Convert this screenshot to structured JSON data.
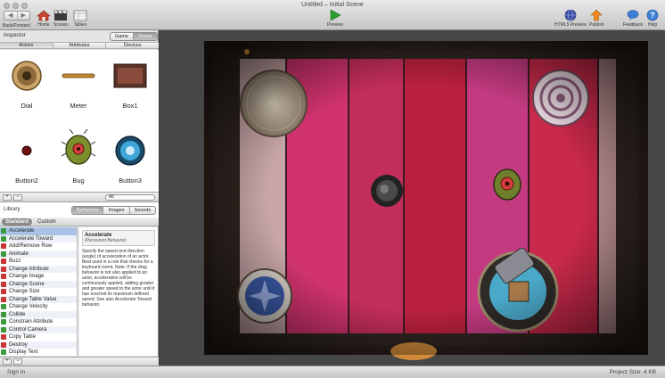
{
  "window": {
    "title": "Untitled – Initial Scene"
  },
  "toolbar": {
    "nav_back": "◀",
    "nav_forward": "▶",
    "nav_label": "Back/Forward",
    "home": "Home",
    "scenes": "Scenes",
    "tables": "Tables",
    "preview": "Preview",
    "html5_preview": "HTML5 Preview",
    "publish": "Publish",
    "feedback": "Feedback",
    "help": "Help"
  },
  "inspector": {
    "title": "Inspector",
    "scope_game": "Game",
    "scope_scene": "Scene",
    "tabs": [
      "Actors",
      "Attributes",
      "Devices"
    ],
    "actors": [
      {
        "name": "Dial",
        "icon": "dial-icon"
      },
      {
        "name": "Meter",
        "icon": "meter-icon"
      },
      {
        "name": "Box1",
        "icon": "box-icon"
      },
      {
        "name": "Button2",
        "icon": "button2-icon"
      },
      {
        "name": "Bug",
        "icon": "bug-icon"
      },
      {
        "name": "Button3",
        "icon": "button3-icon"
      }
    ],
    "add": "+",
    "remove": "−",
    "filter": "All"
  },
  "library": {
    "title": "Library",
    "tabs": [
      "Behaviors",
      "Images",
      "Sounds"
    ],
    "standard": "Standard",
    "custom": "Custom",
    "behaviors": [
      {
        "label": "Accelerate",
        "kind": "g"
      },
      {
        "label": "Accelerate Toward",
        "kind": "g"
      },
      {
        "label": "Add/Remove Row",
        "kind": "r"
      },
      {
        "label": "Animate",
        "kind": "g"
      },
      {
        "label": "Buzz",
        "kind": "r"
      },
      {
        "label": "Change Attribute",
        "kind": "r"
      },
      {
        "label": "Change Image",
        "kind": "r"
      },
      {
        "label": "Change Scene",
        "kind": "r"
      },
      {
        "label": "Change Size",
        "kind": "r"
      },
      {
        "label": "Change Table Value",
        "kind": "r"
      },
      {
        "label": "Change Velocity",
        "kind": "g"
      },
      {
        "label": "Collide",
        "kind": "g"
      },
      {
        "label": "Constrain Attribute",
        "kind": "g"
      },
      {
        "label": "Control Camera",
        "kind": "g"
      },
      {
        "label": "Copy Table",
        "kind": "r"
      },
      {
        "label": "Destroy",
        "kind": "r"
      },
      {
        "label": "Display Text",
        "kind": "g"
      }
    ],
    "description": {
      "title": "Accelerate",
      "subtitle": "(Persistent Behavior)",
      "text": "Specify the speed and direction (angle) of acceleration of an actor. Best used in a rule that checks for a keyboard event. Note: If the drag behavior is not also applied to an actor, acceleration will be continuously applied, adding greater and greater speed to the actor until it has reached its maximum defined speed. See also Accelerate Toward behavior."
    },
    "add": "+",
    "remove": "−"
  },
  "status": {
    "sign_in": "Sign In",
    "project_size": "Project Size: 4 KB"
  },
  "colors": {
    "toolbar_top": "#e9e9e9",
    "toolbar_bottom": "#c6c6c6",
    "selection": "#a9c2e6",
    "stage_bg": "#474747",
    "plank_pink": "#d93a7a",
    "plank_red": "#b31f3a",
    "rail_dark": "#2f2520"
  }
}
